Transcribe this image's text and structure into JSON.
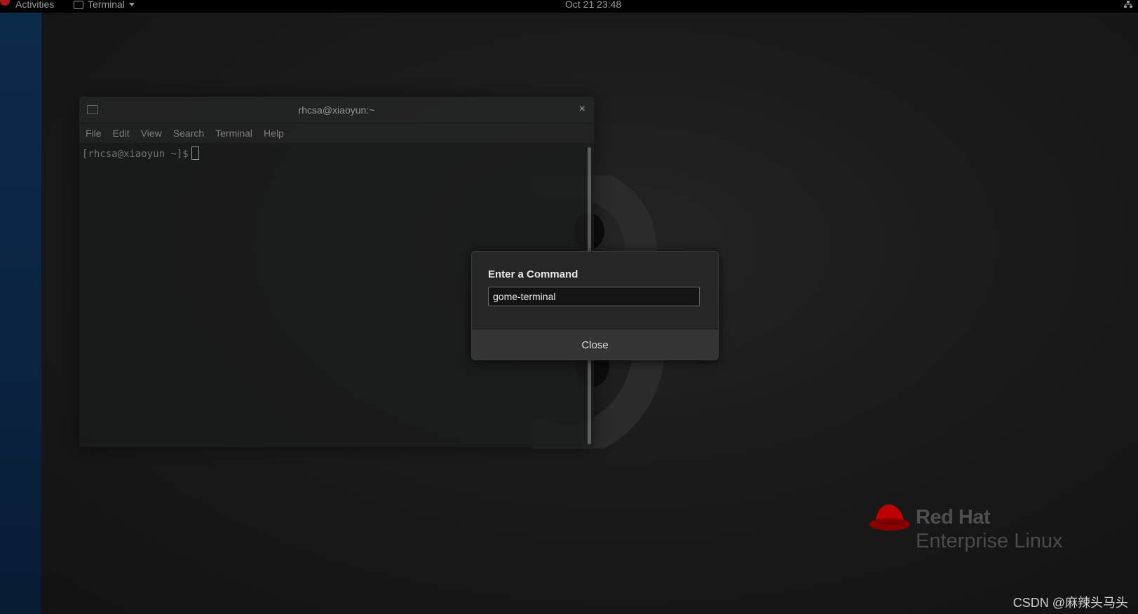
{
  "topbar": {
    "activities": "Activities",
    "app_menu": "Terminal",
    "clock": "Oct 21  23:48"
  },
  "terminal": {
    "title": "rhcsa@xiaoyun:~",
    "close_glyph": "×",
    "menu": [
      "File",
      "Edit",
      "View",
      "Search",
      "Terminal",
      "Help"
    ],
    "prompt": "[rhcsa@xiaoyun ~]$"
  },
  "run_dialog": {
    "title": "Enter a Command",
    "input_value": "gome-terminal",
    "close_label": "Close"
  },
  "branding": {
    "line1": "Red Hat",
    "line2": "Enterprise Linux",
    "hat_color": "#c00000"
  },
  "watermark": "CSDN @麻辣头马头",
  "colors": {
    "topbar_bg": "#000000",
    "left_strip": "#0a2340",
    "desktop_bg": "#1b1b1b",
    "accent_red": "#c00000"
  }
}
